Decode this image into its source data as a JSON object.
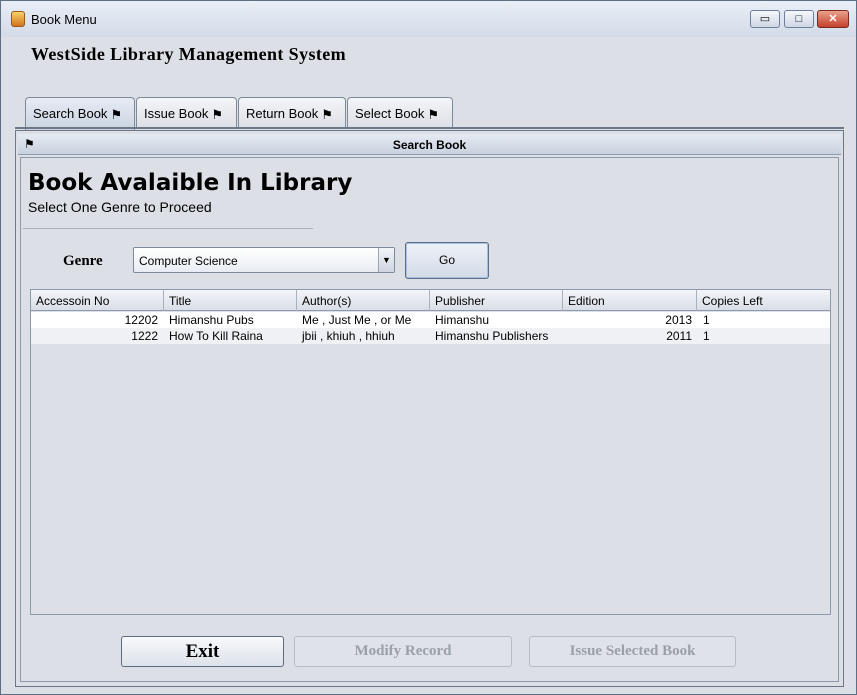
{
  "window": {
    "title": "Book Menu",
    "controls": {
      "minimize": "▭",
      "maximize": "□",
      "close": "✕"
    }
  },
  "header": {
    "title": "WestSide Library Management System"
  },
  "tabs": [
    {
      "label": "Search Book",
      "active": true
    },
    {
      "label": "Issue Book",
      "active": false
    },
    {
      "label": "Return Book",
      "active": false
    },
    {
      "label": "Select Book",
      "active": false
    }
  ],
  "frame": {
    "title": "Search Book"
  },
  "main": {
    "heading": "Book Avalaible In Library",
    "subheading": "Select One Genre to Proceed",
    "genre_label": "Genre",
    "genre_value": "Computer Science",
    "go_label": "Go"
  },
  "table": {
    "columns": [
      "Accessoin No",
      "Title",
      "Author(s)",
      "Publisher",
      "Edition",
      "Copies Left"
    ],
    "rows": [
      [
        "12202",
        "Himanshu Pubs",
        "Me , Just Me , or Me",
        "Himanshu",
        "2013",
        "1"
      ],
      [
        "1222",
        "How To Kill Raina",
        "jbii , khiuh , hhiuh",
        "Himanshu Publishers",
        "2011",
        "1"
      ]
    ]
  },
  "buttons": {
    "exit": "Exit",
    "modify": "Modify Record",
    "issue_selected": "Issue Selected Book"
  },
  "colors": {
    "accent": "#c4402c",
    "disabled_text": "#9aa0a9"
  },
  "icons": [
    "app-icon",
    "flag-icon",
    "pin-icon",
    "dropdown-arrow-icon"
  ]
}
